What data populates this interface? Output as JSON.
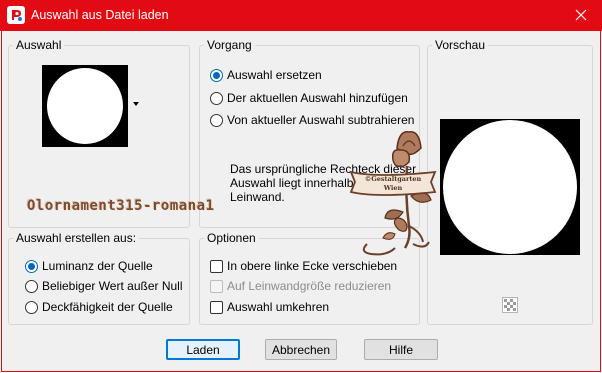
{
  "window": {
    "title": "Auswahl aus Datei laden",
    "close_icon": "close-icon",
    "app_icon": "paintshop-icon",
    "frame_color": "#e30b13"
  },
  "auswahl": {
    "legend": "Auswahl"
  },
  "vorgang": {
    "legend": "Vorgang",
    "options": [
      {
        "label": "Auswahl ersetzen",
        "selected": true
      },
      {
        "label": "Der aktuellen Auswahl hinzufügen",
        "selected": false
      },
      {
        "label": "Von aktueller Auswahl subtrahieren",
        "selected": false
      }
    ],
    "description": [
      "Das ursprüngliche Rechteck dieser",
      "Auswahl liegt innerhalb der",
      "Leinwand."
    ]
  },
  "vorschau": {
    "legend": "Vorschau",
    "checker_icon": "transparency-checker-icon"
  },
  "erstellen": {
    "legend": "Auswahl erstellen aus:",
    "options": [
      {
        "label": "Luminanz der Quelle",
        "selected": true
      },
      {
        "label": "Beliebiger Wert außer Null",
        "selected": false
      },
      {
        "label": "Deckfähigkeit der Quelle",
        "selected": false
      }
    ]
  },
  "optionen": {
    "legend": "Optionen",
    "items": [
      {
        "label": "In obere linke Ecke verschieben",
        "checked": false,
        "enabled": true
      },
      {
        "label": "Auf Leinwandgröße reduzieren",
        "checked": false,
        "enabled": false
      },
      {
        "label": "Auswahl umkehren",
        "checked": false,
        "enabled": true
      }
    ]
  },
  "buttons": {
    "ok": "Laden",
    "cancel": "Abbrechen",
    "help": "Hilfe"
  },
  "overlay": {
    "text": "Olornament315-romana1",
    "logo_text": "©Gestaltgarten Wien"
  }
}
